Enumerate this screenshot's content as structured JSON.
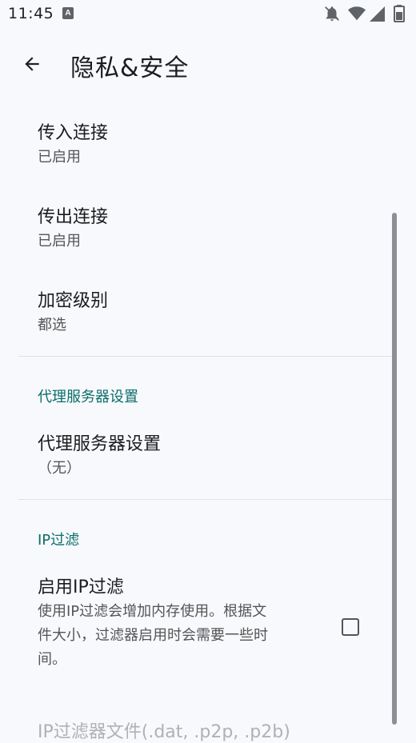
{
  "status_bar": {
    "time": "11:45",
    "app_icon": "A",
    "icons": [
      "notifications-off-icon",
      "wifi-icon",
      "signal-icon",
      "battery-icon"
    ]
  },
  "app_bar": {
    "title": "隐私&安全",
    "back_icon": "arrow-back-icon"
  },
  "preferences": [
    {
      "title": "传入连接",
      "summary": "已启用"
    },
    {
      "title": "传出连接",
      "summary": "已启用"
    },
    {
      "title": "加密级别",
      "summary": "都选"
    }
  ],
  "proxy_section": {
    "header": "代理服务器设置",
    "item": {
      "title": "代理服务器设置",
      "summary": "（无）"
    }
  },
  "ip_filter_section": {
    "header": "IP过滤",
    "enable_item": {
      "title": "启用IP过滤",
      "summary_line1": "使用IP过滤会增加内存使用。根据文",
      "summary_line2": "件大小，过滤器启用时会需要一些时",
      "summary_line3": "间。",
      "checked": false
    },
    "file_item": {
      "title": "IP过滤器文件(.dat, .p2p, .p2b)",
      "enabled": false
    }
  },
  "colors": {
    "accent": "#0a6e6a",
    "background": "#f8f9fd",
    "disabled_text": "#b0b1b5"
  }
}
